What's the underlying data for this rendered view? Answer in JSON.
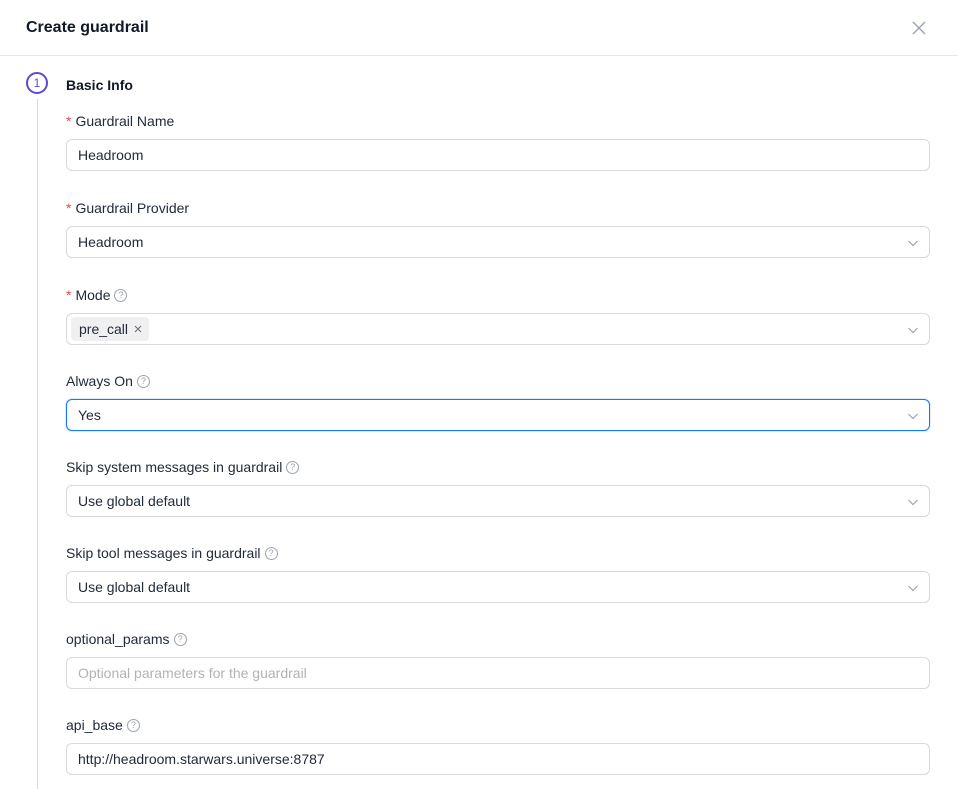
{
  "dialog": {
    "title": "Create guardrail",
    "close_icon": "close-icon"
  },
  "step": {
    "number": "1",
    "title": "Basic Info"
  },
  "fields": {
    "name": {
      "label": "Guardrail Name",
      "required": true,
      "value": "Headroom"
    },
    "provider": {
      "label": "Guardrail Provider",
      "required": true,
      "value": "Headroom"
    },
    "mode": {
      "label": "Mode",
      "required": true,
      "tags": [
        "pre_call"
      ]
    },
    "always_on": {
      "label": "Always On",
      "value": "Yes"
    },
    "skip_system": {
      "label": "Skip system messages in guardrail",
      "value": "Use global default"
    },
    "skip_tool": {
      "label": "Skip tool messages in guardrail",
      "value": "Use global default"
    },
    "optional_params": {
      "label": "optional_params",
      "value": "",
      "placeholder": "Optional parameters for the guardrail"
    },
    "api_base": {
      "label": "api_base",
      "value": "http://headroom.starwars.universe:8787"
    }
  },
  "colors": {
    "accent": "#5b4bd4",
    "focus": "#1677ff",
    "required": "#ef4444"
  }
}
